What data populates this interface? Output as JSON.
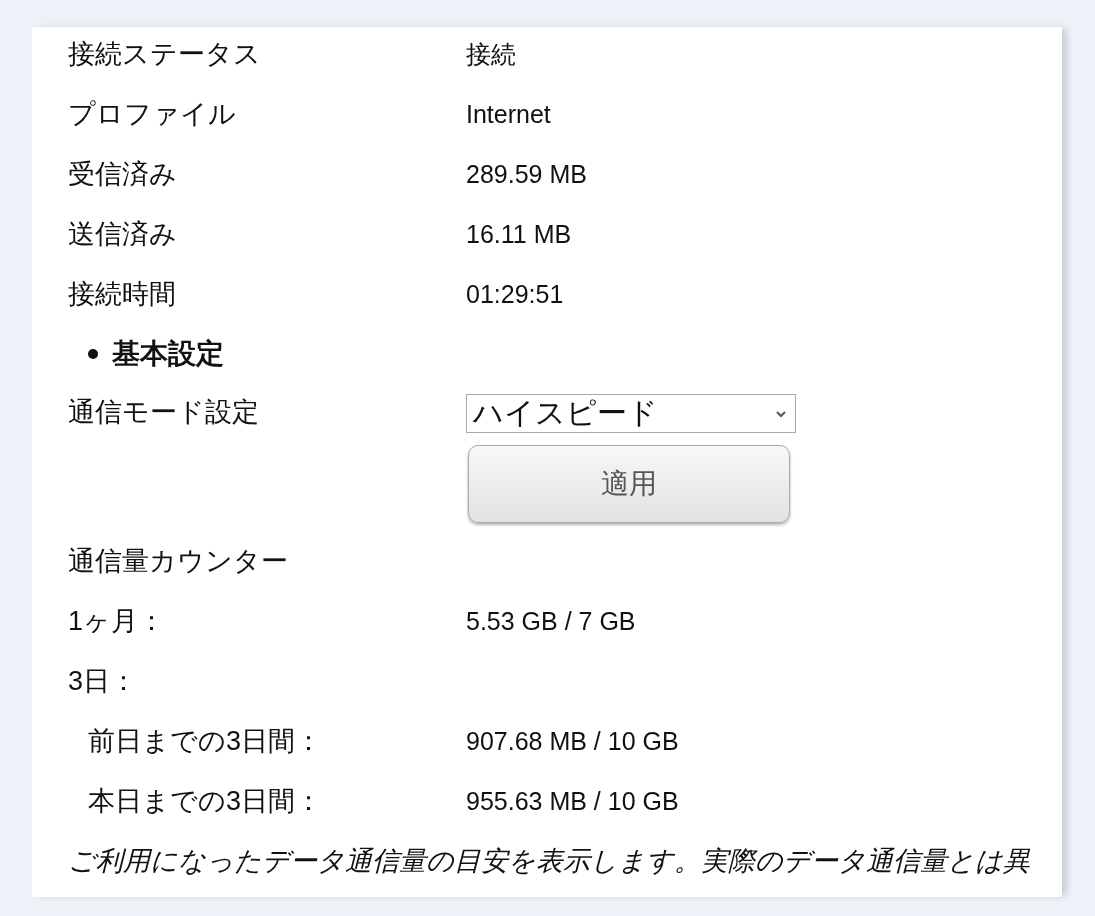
{
  "status_rows": [
    {
      "label": "接続ステータス",
      "value": "接続"
    },
    {
      "label": "プロファイル",
      "value": "Internet"
    },
    {
      "label": "受信済み",
      "value": "289.59 MB"
    },
    {
      "label": "送信済み",
      "value": "16.11 MB"
    },
    {
      "label": "接続時間",
      "value": "01:29:51"
    }
  ],
  "basic_settings": {
    "heading": "基本設定",
    "mode_label": "通信モード設定",
    "mode_value": "ハイスピード",
    "apply_button": "適用"
  },
  "counter": {
    "title": "通信量カウンター",
    "items": [
      {
        "label": "1ヶ月：",
        "value": "5.53 GB / 7 GB"
      },
      {
        "label": "3日：",
        "children": [
          {
            "label": "前日までの3日間：",
            "value": "907.68 MB / 10 GB"
          },
          {
            "label": "本日までの3日間：",
            "value": "955.63 MB / 10 GB"
          }
        ]
      }
    ]
  },
  "note": "ご利用になったデータ通信量の目安を表示します。実際のデータ通信量とは異"
}
